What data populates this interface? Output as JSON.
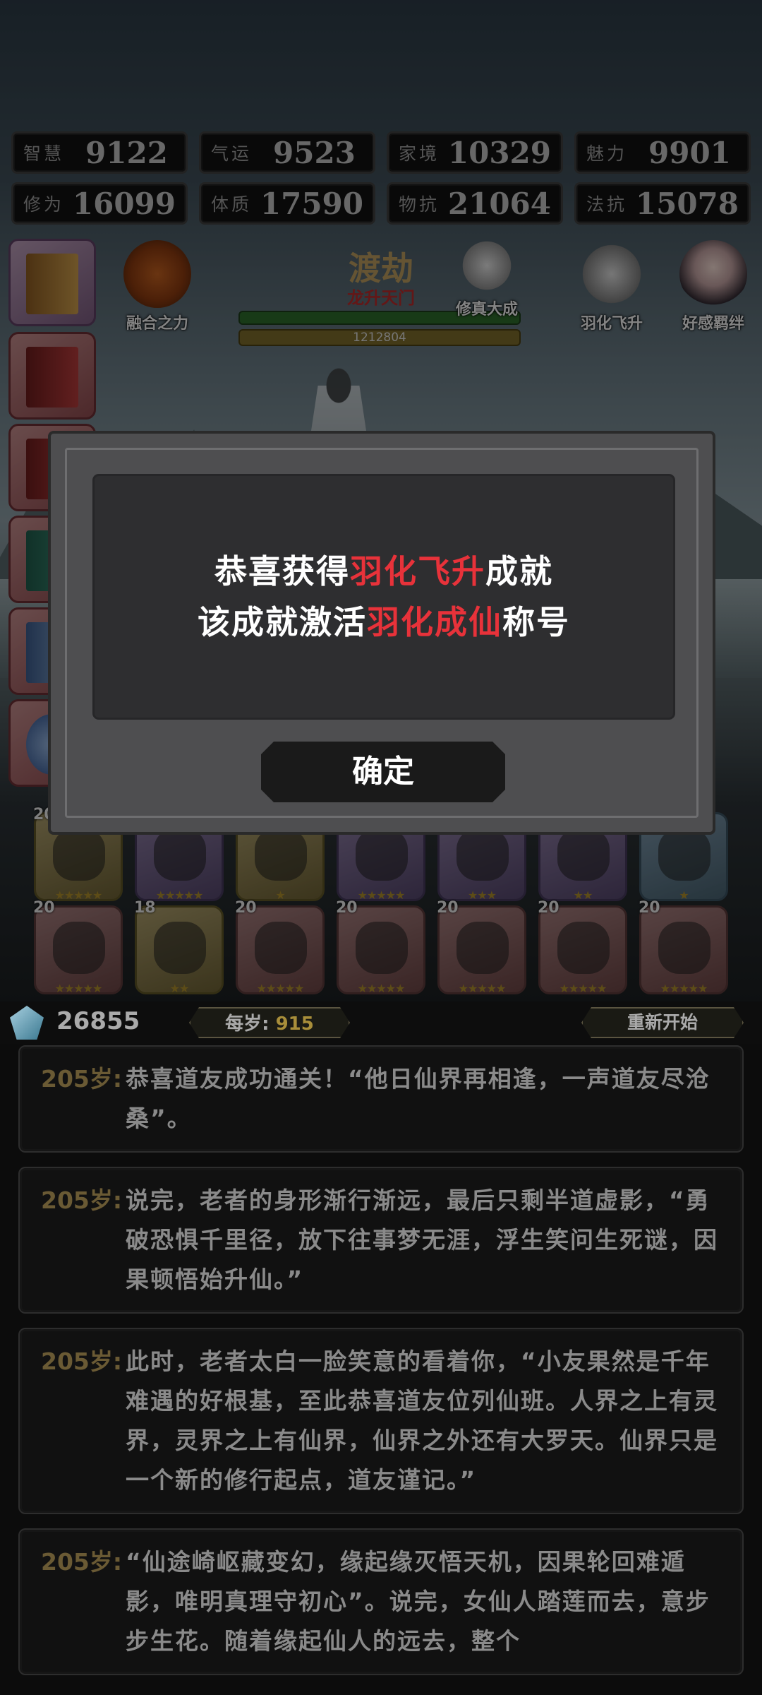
{
  "stats": [
    {
      "label": "智慧",
      "value": "9122"
    },
    {
      "label": "气运",
      "value": "9523"
    },
    {
      "label": "家境",
      "value": "10329"
    },
    {
      "label": "魅力",
      "value": "9901"
    },
    {
      "label": "修为",
      "value": "16099"
    },
    {
      "label": "体质",
      "value": "17590"
    },
    {
      "label": "物抗",
      "value": "21064"
    },
    {
      "label": "法抗",
      "value": "15078"
    }
  ],
  "top_icons": {
    "fusion": "融合之力",
    "realm": "修真大成",
    "ascend": "羽化飞升",
    "favor": "好感羁绊"
  },
  "tribulation": {
    "title": "渡劫",
    "subtitle": "龙升天门",
    "progress_value": "1212804"
  },
  "items_row1_levels": [
    "20",
    "",
    "",
    "",
    "",
    "",
    ""
  ],
  "items_row2": [
    {
      "level": "20",
      "stars": "★★★★★"
    },
    {
      "level": "18",
      "stars": "★★"
    },
    {
      "level": "20",
      "stars": "★★★★★"
    },
    {
      "level": "20",
      "stars": "★★★★★"
    },
    {
      "level": "20",
      "stars": "★★★★★"
    },
    {
      "level": "20",
      "stars": "★★★★★"
    },
    {
      "level": "20",
      "stars": "★★★★★"
    }
  ],
  "items_row1_stars": [
    "★★★★★",
    "★★★★★",
    "★",
    "★★★★★",
    "★★★",
    "★★",
    "★"
  ],
  "resources": {
    "gems": "26855",
    "per_age_label": "每岁:",
    "per_age_value": "915",
    "restart_label": "重新开始"
  },
  "log": [
    {
      "age": "205岁:",
      "text": "恭喜道友成功通关！“他日仙界再相逢，一声道友尽沧桑”。"
    },
    {
      "age": "205岁:",
      "text": "说完，老者的身形渐行渐远，最后只剩半道虚影，“勇破恐惧千里径，放下往事梦无涯，浮生笑问生死谜，因果顿悟始升仙。”"
    },
    {
      "age": "205岁:",
      "text": "此时，老者太白一脸笑意的看着你，“小友果然是千年难遇的好根基，至此恭喜道友位列仙班。人界之上有灵界，灵界之上有仙界，仙界之外还有大罗天。仙界只是一个新的修行起点，道友谨记。”"
    },
    {
      "age": "205岁:",
      "text": "“仙途崎岖藏变幻，缘起缘灭悟天机，因果轮回难遁影，唯明真理守初心”。说完，女仙人踏莲而去，意步步生花。随着缘起仙人的远去，整个"
    }
  ],
  "modal": {
    "line1_pre": "恭喜获得",
    "line1_hl": "羽化飞升",
    "line1_post": "成就",
    "line2_pre": "该成就激活",
    "line2_hl": "羽化成仙",
    "line2_post": "称号",
    "confirm": "确定",
    "highlight_color": "#e8323a"
  }
}
